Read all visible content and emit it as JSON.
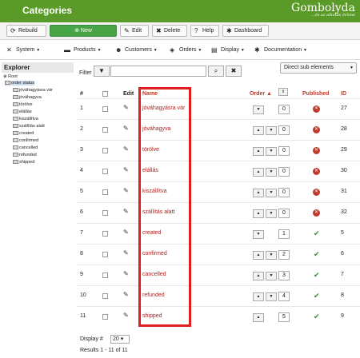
{
  "header": {
    "title": "Categories",
    "logo": "Gombolyda",
    "logo_tagline": "...és az alkotás öröme"
  },
  "toolbar": {
    "rebuild": "Rebuild",
    "new": "New",
    "edit": "Edit",
    "delete": "Delete",
    "help": "Help",
    "dashboard": "Dashboard"
  },
  "menu": {
    "system": "System",
    "products": "Products",
    "customers": "Customers",
    "orders": "Orders",
    "display": "Display",
    "documentation": "Documentation"
  },
  "explorer": {
    "title": "Explorer",
    "root": "Root",
    "selected": "order status",
    "children": [
      "jóváhagyásra vár",
      "jóváhagyva",
      "törölve",
      "elállás",
      "kiszállítva",
      "szállítás alatt",
      "created",
      "confirmed",
      "cancelled",
      "refunded",
      "shipped"
    ]
  },
  "filter": {
    "label": "Filter",
    "value": ""
  },
  "view_select": "Direct sub elements",
  "columns": {
    "num": "#",
    "edit": "Edit",
    "name": "Name",
    "order": "Order",
    "published": "Published",
    "id": "ID"
  },
  "rows": [
    {
      "num": "1",
      "name": "jóváhagyásra vár",
      "order": "0",
      "published": false,
      "id": "27"
    },
    {
      "num": "2",
      "name": "jóváhagyva",
      "order": "0",
      "published": false,
      "id": "28"
    },
    {
      "num": "3",
      "name": "törölve",
      "order": "0",
      "published": false,
      "id": "29"
    },
    {
      "num": "4",
      "name": "elállás",
      "order": "0",
      "published": false,
      "id": "30"
    },
    {
      "num": "5",
      "name": "kiszállítva",
      "order": "0",
      "published": false,
      "id": "31"
    },
    {
      "num": "6",
      "name": "szállítás alatt",
      "order": "0",
      "published": false,
      "id": "32"
    },
    {
      "num": "7",
      "name": "created",
      "order": "1",
      "published": true,
      "id": "5"
    },
    {
      "num": "8",
      "name": "confirmed",
      "order": "2",
      "published": true,
      "id": "6"
    },
    {
      "num": "9",
      "name": "cancelled",
      "order": "3",
      "published": true,
      "id": "7"
    },
    {
      "num": "10",
      "name": "refunded",
      "order": "4",
      "published": true,
      "id": "8"
    },
    {
      "num": "11",
      "name": "shipped",
      "order": "5",
      "published": true,
      "id": "9"
    }
  ],
  "footer": {
    "display_label": "Display #",
    "display_value": "20",
    "results": "Results 1 - 11 of 11"
  },
  "colors": {
    "accent": "#5a9a28",
    "highlight": "#e02020"
  }
}
